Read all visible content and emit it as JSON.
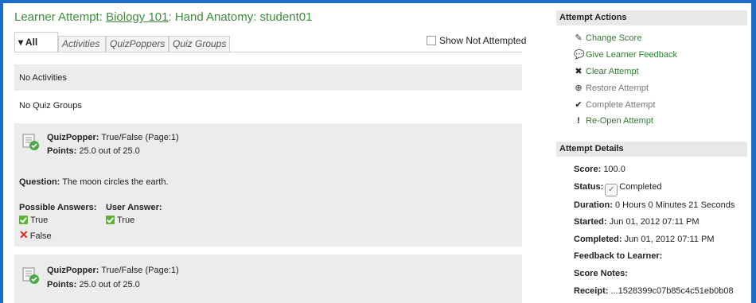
{
  "header": {
    "prefix": "Learner Attempt: ",
    "course_link": "Biology 101",
    "suffix": ": Hand Anatomy: student01"
  },
  "tabs": [
    {
      "label": "▾ All",
      "active": true
    },
    {
      "label": "Activities",
      "active": false
    },
    {
      "label": "QuizPoppers",
      "active": false
    },
    {
      "label": "Quiz Groups",
      "active": false
    }
  ],
  "show_not_attempted": {
    "label": "Show Not Attempted",
    "checked": false
  },
  "sections": {
    "no_activities": "No Activities",
    "no_quiz_groups": "No Quiz Groups"
  },
  "quizpoppers": [
    {
      "type_label": "QuizPopper:",
      "type_value": "True/False  (Page:1)",
      "points_label": "Points:",
      "points_value": "25.0 out of 25.0",
      "question_label": "Question:",
      "question_text": "The moon circles the earth.",
      "possible_answers_label": "Possible Answers:",
      "user_answer_label": "User Answer:",
      "answers": [
        {
          "text": "True",
          "correct": true
        },
        {
          "text": "False",
          "correct": false
        }
      ],
      "user_answer": "True"
    },
    {
      "type_label": "QuizPopper:",
      "type_value": "True/False  (Page:1)",
      "points_label": "Points:",
      "points_value": "25.0 out of 25.0"
    }
  ],
  "attempt_actions": {
    "heading": "Attempt Actions",
    "items": [
      {
        "label": "Change Score",
        "icon": "pencil-icon",
        "enabled": true
      },
      {
        "label": "Give Learner Feedback",
        "icon": "speech-bubble-icon",
        "enabled": true
      },
      {
        "label": "Clear Attempt",
        "icon": "clear-x-circle-icon",
        "enabled": true
      },
      {
        "label": "Restore Attempt",
        "icon": "restore-plus-circle-icon",
        "enabled": false
      },
      {
        "label": "Complete Attempt",
        "icon": "checkmark-icon",
        "enabled": false
      },
      {
        "label": "Re-Open Attempt",
        "icon": "exclamation-icon",
        "enabled": true
      }
    ]
  },
  "attempt_details": {
    "heading": "Attempt Details",
    "score_label": "Score:",
    "score_value": "100.0",
    "status_label": "Status:",
    "status_value": "Completed",
    "duration_label": "Duration:",
    "duration_value": "0 Hours 0 Minutes 21 Seconds",
    "started_label": "Started:",
    "started_value": "Jun 01, 2012 07:11 PM",
    "completed_label": "Completed:",
    "completed_value": "Jun 01, 2012 07:11 PM",
    "feedback_label": "Feedback to Learner:",
    "score_notes_label": "Score Notes:",
    "receipt_label": "Receipt:",
    "receipt_value": "...1528399c07b85c4c51eb0b08"
  },
  "colors": {
    "frame": "#1d6cc7",
    "accent_green": "#3d8b3d",
    "panel_grey": "#ececec"
  }
}
